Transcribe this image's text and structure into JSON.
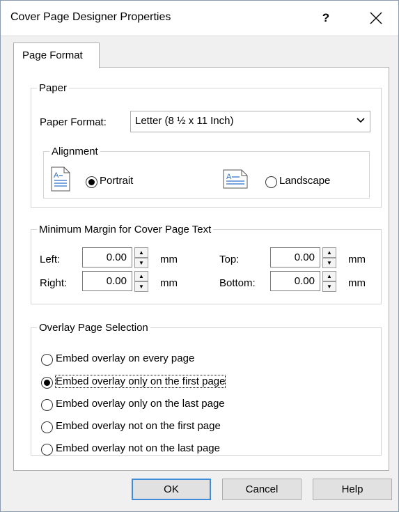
{
  "window": {
    "title": "Cover Page Designer Properties",
    "help": "?",
    "close": "✕"
  },
  "tabs": [
    {
      "label": "Page Format"
    }
  ],
  "paper": {
    "legend": "Paper",
    "format_label": "Paper Format:",
    "format_value": "Letter (8 ½ x 11 Inch)",
    "alignment": {
      "legend": "Alignment",
      "portrait_label": "Portrait",
      "landscape_label": "Landscape",
      "selected": "Portrait"
    }
  },
  "margins": {
    "legend": "Minimum Margin for Cover Page Text",
    "unit": "mm",
    "left": {
      "label": "Left:",
      "value": "0.00"
    },
    "right": {
      "label": "Right:",
      "value": "0.00"
    },
    "top": {
      "label": "Top:",
      "value": "0.00"
    },
    "bottom": {
      "label": "Bottom:",
      "value": "0.00"
    }
  },
  "overlay": {
    "legend": "Overlay Page Selection",
    "options": [
      {
        "label": "Embed overlay on every page",
        "selected": false
      },
      {
        "label": "Embed overlay only on the first page",
        "selected": true
      },
      {
        "label": "Embed overlay only on the last page",
        "selected": false
      },
      {
        "label": "Embed overlay not on the first page",
        "selected": false
      },
      {
        "label": "Embed overlay not on the last page",
        "selected": false
      }
    ]
  },
  "buttons": {
    "ok": "OK",
    "cancel": "Cancel",
    "help": "Help"
  },
  "icons": {
    "portrait": "portrait-page-icon",
    "landscape": "landscape-page-icon"
  },
  "colors": {
    "accent": "#3d8bd9",
    "icon_blue": "#2a6fc9"
  }
}
